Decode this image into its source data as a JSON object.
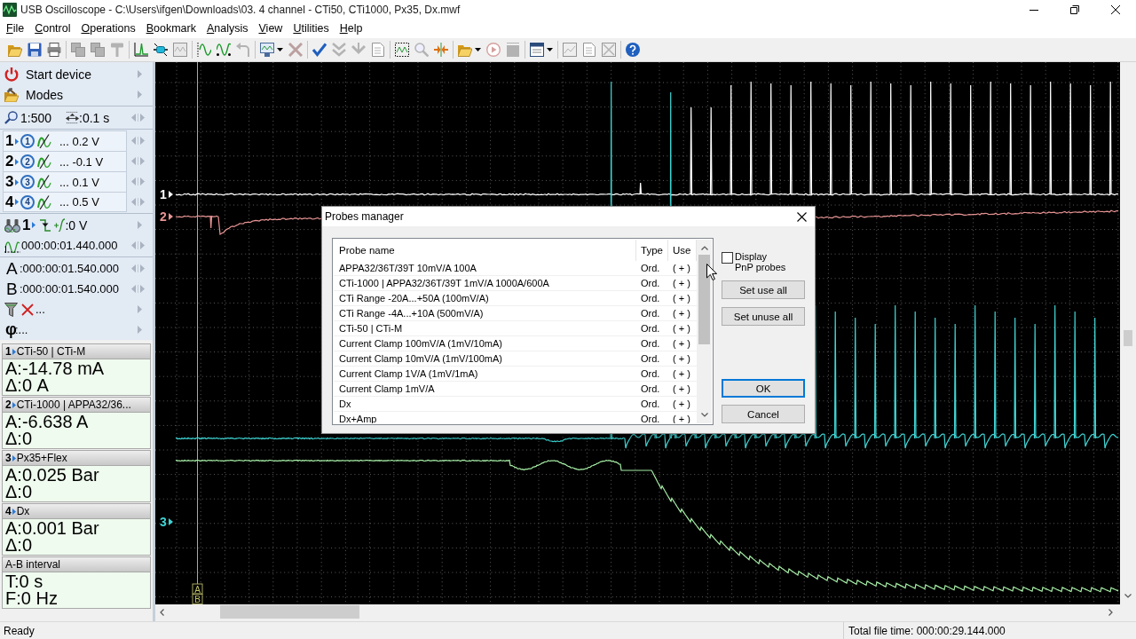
{
  "window": {
    "title": "USB Oscilloscope - C:\\Users\\ifgen\\Downloads\\03. 4 channel - CTi50, CTi1000, Px35, Dx.mwf"
  },
  "menu": [
    "File",
    "Control",
    "Operations",
    "Bookmark",
    "Analysis",
    "View",
    "Utilities",
    "Help"
  ],
  "toolbar": [
    [
      {
        "kind": "open",
        "disabled": false
      },
      {
        "kind": "save",
        "disabled": false
      },
      {
        "kind": "print",
        "disabled": false
      }
    ],
    [
      {
        "kind": "copy",
        "disabled": true
      },
      {
        "kind": "copy",
        "disabled": true
      },
      {
        "kind": "hammer",
        "disabled": true
      }
    ],
    [
      {
        "kind": "peak",
        "disabled": false
      },
      {
        "kind": "probe",
        "disabled": false
      },
      {
        "kind": "compare",
        "disabled": true
      }
    ],
    [
      {
        "kind": "cursor-wave",
        "disabled": false
      },
      {
        "kind": "wave",
        "disabled": false
      },
      {
        "kind": "undo",
        "disabled": true
      }
    ],
    [
      {
        "kind": "monitor",
        "disabled": false
      },
      {
        "kind": "caret",
        "disabled": false
      },
      {
        "kind": "cross",
        "disabled": true
      }
    ],
    [
      {
        "kind": "check",
        "disabled": false
      },
      {
        "kind": "double-check",
        "disabled": true
      },
      {
        "kind": "check-down",
        "disabled": true
      },
      {
        "kind": "document",
        "disabled": true
      }
    ],
    [
      {
        "kind": "select",
        "disabled": false
      },
      {
        "kind": "zoom",
        "disabled": true
      },
      {
        "kind": "arrows",
        "disabled": false
      }
    ],
    [
      {
        "kind": "folder",
        "disabled": false
      },
      {
        "kind": "caret",
        "disabled": false
      },
      {
        "kind": "record",
        "disabled": true
      },
      {
        "kind": "stop",
        "disabled": true
      }
    ],
    [
      {
        "kind": "window",
        "disabled": false
      },
      {
        "kind": "caret",
        "disabled": false
      }
    ],
    [
      {
        "kind": "chart",
        "disabled": true
      },
      {
        "kind": "document",
        "disabled": true
      },
      {
        "kind": "crossed",
        "disabled": true
      }
    ],
    [
      {
        "kind": "help",
        "disabled": false
      }
    ]
  ],
  "side_panel": {
    "commands": [
      {
        "kind": "power",
        "label": "Start device"
      },
      {
        "kind": "modes",
        "label": "Modes"
      }
    ],
    "scale": {
      "zoom": "1:500",
      "time": ":0.1 s"
    },
    "channels": [
      {
        "number": "1",
        "badge": "1",
        "range": "... 0.2 V"
      },
      {
        "number": "2",
        "badge": "2",
        "range": "... -0.1 V"
      },
      {
        "number": "3",
        "badge": "3",
        "range": "... 0.1 V"
      },
      {
        "number": "4",
        "badge": "4",
        "range": "... 0.5 V"
      }
    ],
    "trigger": {
      "channel": "1",
      "level": ":0 V"
    },
    "trigger_position": "000:00:01.440.000",
    "cursors": [
      {
        "label": "A",
        "time": ":000:00:01.540.000"
      },
      {
        "label": "B",
        "time": ":000:00:01.540.000"
      }
    ],
    "filter": "...",
    "phase": {
      "label": "φ",
      "value": ":..."
    }
  },
  "measurements": [
    {
      "number": "1",
      "title": "CTi-50 | CTi-M",
      "reading": "A:-14.78 mA",
      "delta": "Δ:0 A"
    },
    {
      "number": "2",
      "title": "CTi-1000 | APPA32/36...",
      "reading": "A:-6.638 A",
      "delta": "Δ:0"
    },
    {
      "number": "3",
      "title": "Px35+Flex",
      "reading": "A:0.025 Bar",
      "delta": "Δ:0"
    },
    {
      "number": "4",
      "title": "Dx",
      "reading": "A:0.001 Bar",
      "delta": "Δ:0"
    }
  ],
  "interval": {
    "title": "A-B interval",
    "lines": [
      "T:0 s",
      "F:0 Hz"
    ]
  },
  "plot": {
    "channels": [
      {
        "marker": "1",
        "color": "#ffffff"
      },
      {
        "marker": "2",
        "color": "#e89494"
      },
      {
        "marker": "3",
        "color": "#3fd4d4"
      },
      {
        "color": "#a6eea6"
      }
    ],
    "cursor_tags": [
      "A",
      "B"
    ]
  },
  "dialog": {
    "title": "Probes manager",
    "columns": [
      "Probe name",
      "Type",
      "Use"
    ],
    "rows": [
      {
        "name": "APPA32/36T/39T 10mV/A 100A",
        "type": "Ord.",
        "use": "( + )"
      },
      {
        "name": "CTi-1000 | APPA32/36T/39T 1mV/A 1000A/600A",
        "type": "Ord.",
        "use": "( + )"
      },
      {
        "name": "CTi Range -20A...+50A (100mV/A)",
        "type": "Ord.",
        "use": "( + )"
      },
      {
        "name": "CTi Range -4A...+10A (500mV/A)",
        "type": "Ord.",
        "use": "( + )"
      },
      {
        "name": "CTi-50 | CTi-M",
        "type": "Ord.",
        "use": "( + )"
      },
      {
        "name": "Current Clamp 100mV/A (1mV/10mA)",
        "type": "Ord.",
        "use": "( + )"
      },
      {
        "name": "Current Clamp 10mV/A (1mV/100mA)",
        "type": "Ord.",
        "use": "( + )"
      },
      {
        "name": "Current Clamp 1V/A (1mV/1mA)",
        "type": "Ord.",
        "use": "( + )"
      },
      {
        "name": "Current Clamp 1mV/A",
        "type": "Ord.",
        "use": "( + )"
      },
      {
        "name": "Dx",
        "type": "Ord.",
        "use": "( + )"
      },
      {
        "name": "Dx+Amp",
        "type": "Ord.",
        "use": "( + )"
      }
    ],
    "checkbox": {
      "label": "Display PnP probes",
      "checked": false
    },
    "side_buttons": [
      {
        "label": "Set use all",
        "default": false
      },
      {
        "label": "Set unuse all",
        "default": false
      }
    ],
    "footer_buttons": [
      {
        "label": "OK",
        "default": true
      },
      {
        "label": "Cancel",
        "default": false
      }
    ]
  },
  "status_bar": {
    "message": "Ready",
    "file_time": "Total file time: 000:00:29.144.000"
  }
}
